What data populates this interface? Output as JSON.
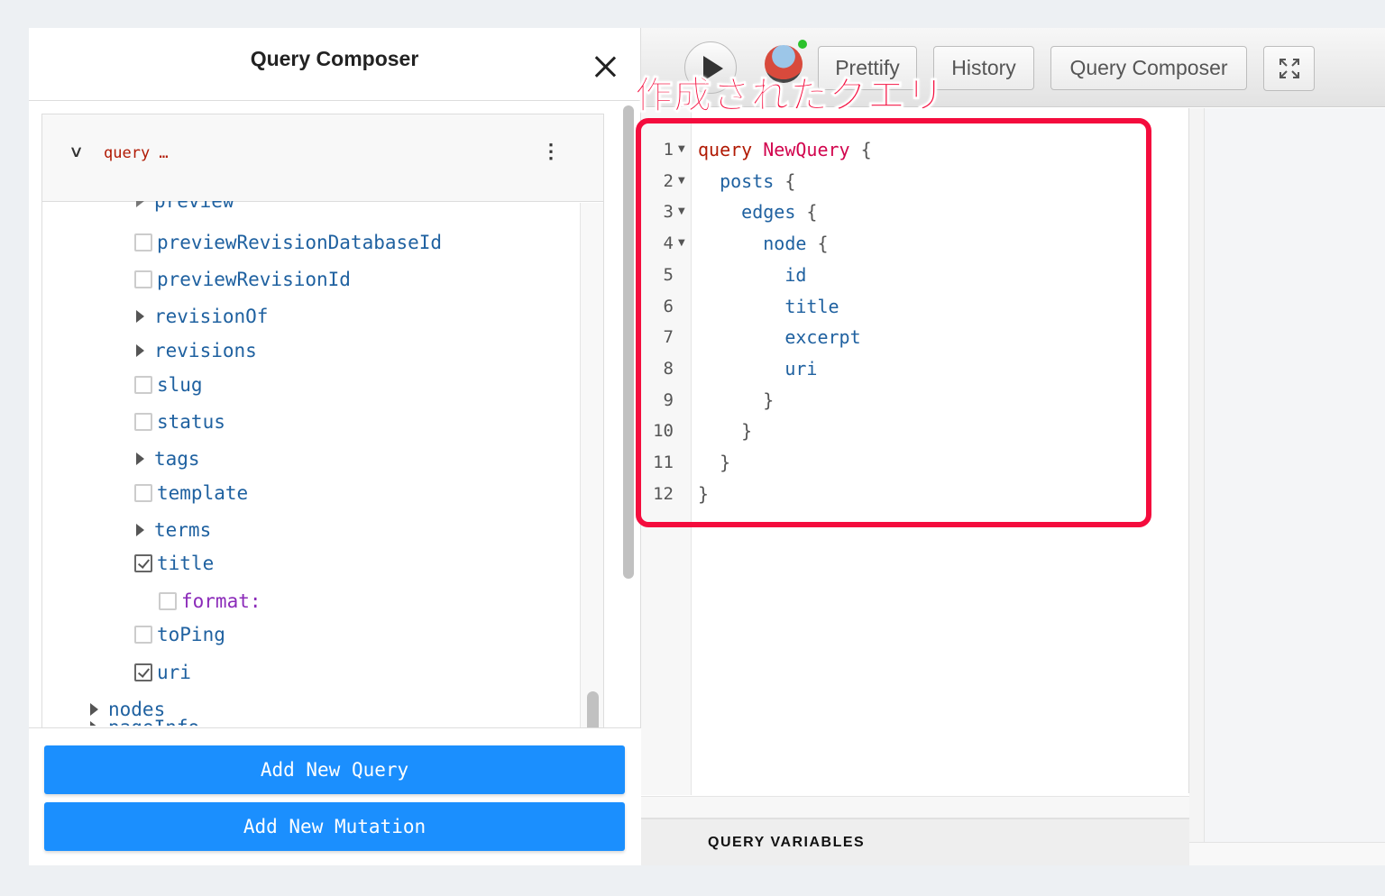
{
  "composer": {
    "title": "Query Composer",
    "query_label": "query …",
    "partially_visible_top_item": "preview",
    "partially_visible_bottom_item": "pageInfo",
    "fields": [
      {
        "name": "previewRevisionDatabaseId",
        "kind": "checkbox",
        "checked": false
      },
      {
        "name": "previewRevisionId",
        "kind": "checkbox",
        "checked": false
      },
      {
        "name": "revisionOf",
        "kind": "expandable"
      },
      {
        "name": "revisions",
        "kind": "expandable"
      },
      {
        "name": "slug",
        "kind": "checkbox",
        "checked": false
      },
      {
        "name": "status",
        "kind": "checkbox",
        "checked": false
      },
      {
        "name": "tags",
        "kind": "expandable"
      },
      {
        "name": "template",
        "kind": "checkbox",
        "checked": false
      },
      {
        "name": "terms",
        "kind": "expandable"
      },
      {
        "name": "title",
        "kind": "checkbox",
        "checked": true
      },
      {
        "name": "format:",
        "kind": "argument",
        "checked": false
      },
      {
        "name": "toPing",
        "kind": "checkbox",
        "checked": false
      },
      {
        "name": "uri",
        "kind": "checkbox",
        "checked": true
      },
      {
        "name": "nodes",
        "kind": "expandable"
      }
    ],
    "add_query_label": "Add New Query",
    "add_mutation_label": "Add New Mutation"
  },
  "toolbar": {
    "prettify_label": "Prettify",
    "history_label": "History",
    "query_composer_label": "Query Composer",
    "run_icon": "play-icon",
    "fullscreen_icon": "expand-icon"
  },
  "editor": {
    "lines": [
      {
        "n": "1",
        "fold": true,
        "text": "query NewQuery {"
      },
      {
        "n": "2",
        "fold": true,
        "text": "  posts {"
      },
      {
        "n": "3",
        "fold": true,
        "text": "    edges {"
      },
      {
        "n": "4",
        "fold": true,
        "text": "      node {"
      },
      {
        "n": "5",
        "fold": false,
        "text": "        id"
      },
      {
        "n": "6",
        "fold": false,
        "text": "        title"
      },
      {
        "n": "7",
        "fold": false,
        "text": "        excerpt"
      },
      {
        "n": "8",
        "fold": false,
        "text": "        uri"
      },
      {
        "n": "9",
        "fold": false,
        "text": "      }"
      },
      {
        "n": "10",
        "fold": false,
        "text": "    }"
      },
      {
        "n": "11",
        "fold": false,
        "text": "  }"
      },
      {
        "n": "12",
        "fold": false,
        "text": "}"
      }
    ],
    "query_variables_label": "QUERY VARIABLES"
  },
  "annotation": {
    "text": "作成されたクエリ",
    "color": "#f40c3d"
  },
  "colors": {
    "button_blue": "#1b8ffe",
    "keyword": "#b11a04",
    "definition": "#d2054e",
    "property": "#1f61a0",
    "argument": "#8b2bb9"
  }
}
